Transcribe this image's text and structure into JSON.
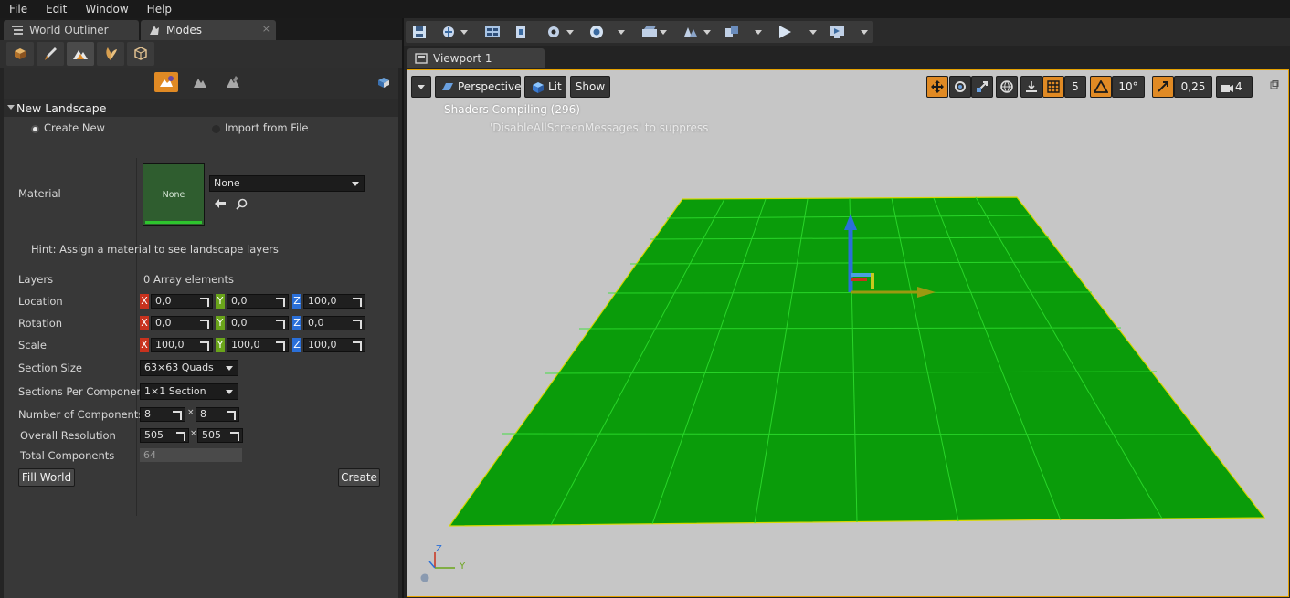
{
  "menu": [
    "File",
    "Edit",
    "Window",
    "Help"
  ],
  "left_tabs": [
    {
      "label": "World Outliner"
    },
    {
      "label": "Modes",
      "close": "×"
    }
  ],
  "landscape": {
    "section_title": "New Landscape",
    "create_new_label": "Create New",
    "import_label": "Import from File",
    "material_label": "Material",
    "material_thumb_text": "None",
    "material_combo_value": "None",
    "hint": "Hint: Assign a material to see landscape layers",
    "layers_label": "Layers",
    "layers_value": "0 Array elements",
    "location_label": "Location",
    "location": {
      "x": "0,0",
      "y": "0,0",
      "z": "100,0"
    },
    "rotation_label": "Rotation",
    "rotation": {
      "x": "0,0",
      "y": "0,0",
      "z": "0,0"
    },
    "scale_label": "Scale",
    "scale": {
      "x": "100,0",
      "y": "100,0",
      "z": "100,0"
    },
    "axis_x": "X",
    "axis_y": "Y",
    "axis_z": "Z",
    "section_size_label": "Section Size",
    "section_size_value": "63×63 Quads",
    "sections_per_component_label": "Sections Per Component",
    "sections_per_component_value": "1×1 Section",
    "num_components_label": "Number of Components",
    "num_components_x": "8",
    "num_components_y": "8",
    "times": "×",
    "overall_resolution_label": "Overall Resolution",
    "overall_resolution_x": "505",
    "overall_resolution_y": "505",
    "total_components_label": "Total Components",
    "total_components_value": "64",
    "fill_world_label": "Fill World",
    "create_label": "Create"
  },
  "viewport": {
    "tab_label": "Viewport 1",
    "perspective_label": "Perspective",
    "lit_label": "Lit",
    "show_label": "Show",
    "grid_snap_value": "5",
    "rotation_snap_value": "10°",
    "scale_snap_value": "0,25",
    "camera_speed_value": "4",
    "message_1": "Shaders Compiling (296)",
    "message_2": "'DisableAllScreenMessages' to suppress",
    "axis_z": "Z",
    "axis_y": "Y"
  },
  "colors": {
    "accent_orange": "#e08a24",
    "axis_x_red": "#c8321e",
    "axis_y_green": "#6aa51a",
    "axis_z_blue": "#2a6fd8",
    "landscape_green": "#0a9c0a",
    "viewport_bg": "#c6c6c6",
    "selection_yellow": "#e5a100"
  }
}
